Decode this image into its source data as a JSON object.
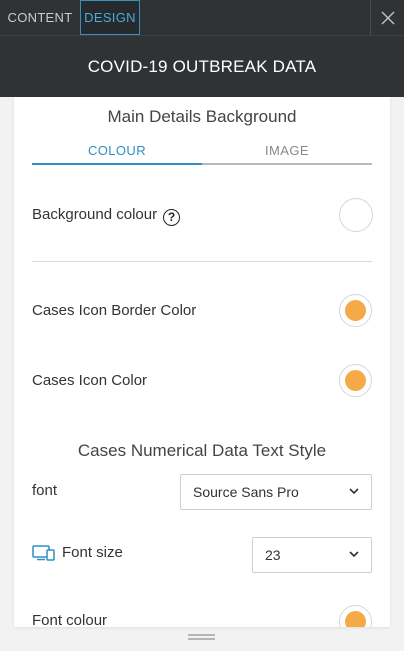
{
  "tabs": {
    "content_label": "CONTENT",
    "design_label": "DESIGN"
  },
  "header": {
    "title": "COVID-19 OUTBREAK DATA"
  },
  "background_section": {
    "title": "Main Details Background",
    "subtabs": {
      "colour": "COLOUR",
      "image": "IMAGE"
    },
    "background_colour_label": "Background colour",
    "help_glyph": "?",
    "background_colour_value": "#ffffff"
  },
  "icon_settings": {
    "border_color_label": "Cases Icon Border Color",
    "border_color_value": "#f5aa47",
    "icon_color_label": "Cases Icon Color",
    "icon_color_value": "#f5aa47"
  },
  "numeric_text_style": {
    "title": "Cases Numerical Data Text Style",
    "font_label": "font",
    "font_value": "Source Sans Pro",
    "font_size_label": "Font size",
    "font_size_value": "23",
    "font_colour_label": "Font colour",
    "font_colour_value": "#f5aa47"
  },
  "colors": {
    "accent": "#2f8fc4",
    "toolbar_bg": "#2f3336",
    "swatch_orange": "#f5aa47"
  },
  "icons": [
    "close-icon",
    "help-icon",
    "chevron-down-icon",
    "device-icon",
    "drag-handle-icon"
  ]
}
